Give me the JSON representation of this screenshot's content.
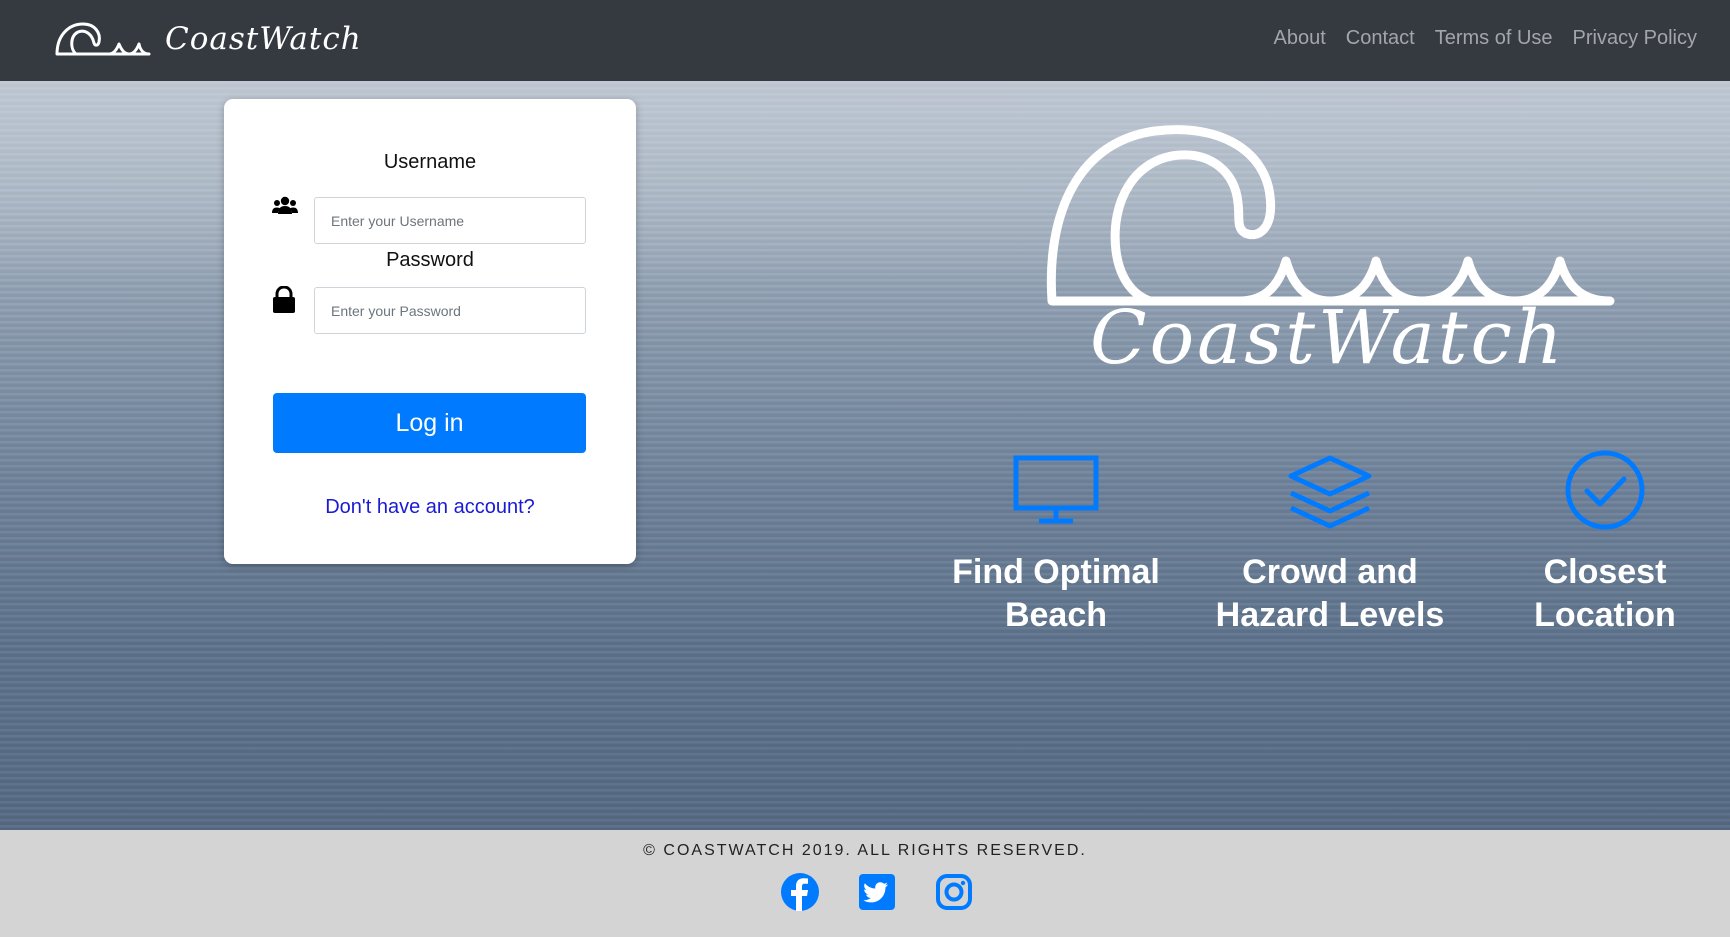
{
  "brand": {
    "name": "CoastWatch",
    "logo_icon": "wave-logo-icon"
  },
  "nav": {
    "links": [
      "About",
      "Contact",
      "Terms of Use",
      "Privacy Policy"
    ]
  },
  "login": {
    "username_label": "Username",
    "username_placeholder": "Enter your Username",
    "username_value": "",
    "username_icon": "users-icon",
    "password_label": "Password",
    "password_placeholder": "Enter your Password",
    "password_value": "",
    "password_icon": "lock-icon",
    "submit_label": "Log in",
    "signup_link": "Don't have an account?"
  },
  "hero": {
    "logo_text": "CoastWatch",
    "features": [
      {
        "icon": "monitor-icon",
        "line1": "Find Optimal",
        "line2": "Beach"
      },
      {
        "icon": "layers-icon",
        "line1": "Crowd and",
        "line2": "Hazard Levels"
      },
      {
        "icon": "check-circle-icon",
        "line1": "Closest",
        "line2": "Location"
      }
    ]
  },
  "footer": {
    "copyright": "© COASTWATCH 2019. ALL RIGHTS RESERVED.",
    "socials": [
      "facebook-icon",
      "twitter-icon",
      "instagram-icon"
    ]
  },
  "colors": {
    "navbar": "#343a40",
    "primary": "#007bff",
    "link": "#1a1ad6",
    "footer": "#d4d4d4"
  }
}
